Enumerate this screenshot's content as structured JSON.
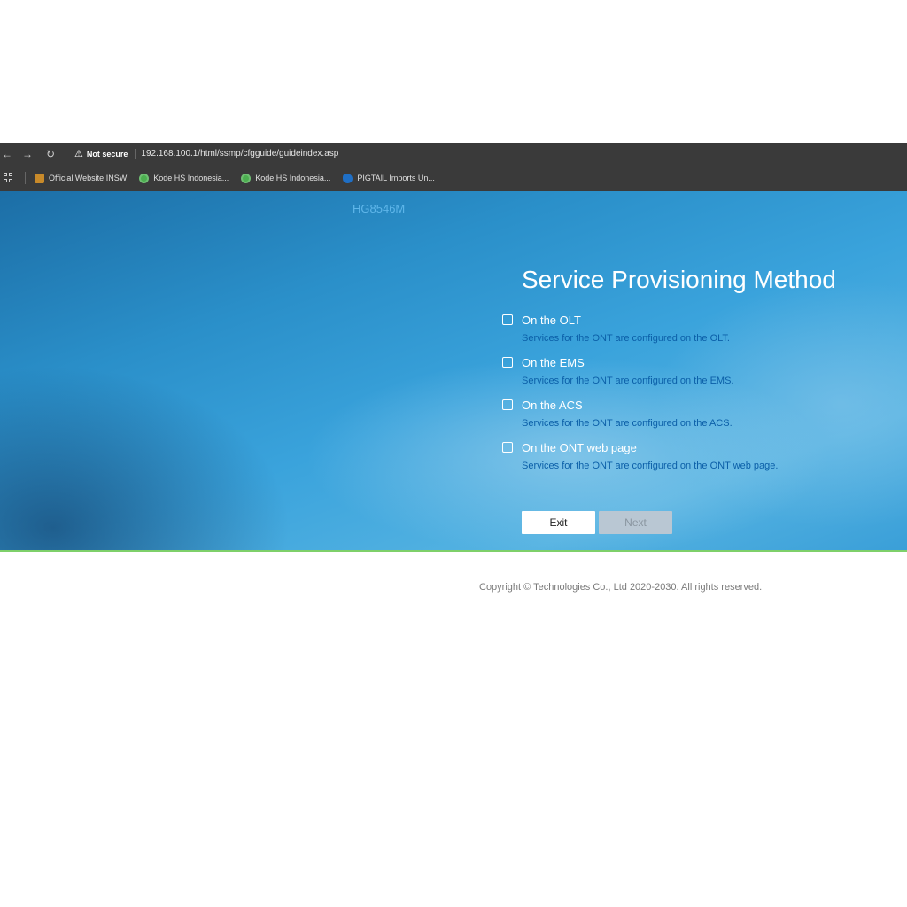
{
  "browser": {
    "nav": {
      "back": "←",
      "forward": "→",
      "reload": "↻"
    },
    "security_warning_glyph": "⚠",
    "security_label": "Not secure",
    "url": "192.168.100.1/html/ssmp/cfgguide/guideindex.asp",
    "bookmarks": [
      {
        "label": "Official Website INSW",
        "icon": "insw-favicon"
      },
      {
        "label": "Kode HS Indonesia...",
        "icon": "kode-hs-favicon"
      },
      {
        "label": "Kode HS Indonesia...",
        "icon": "kode-hs-favicon"
      },
      {
        "label": "PIGTAIL Imports Un...",
        "icon": "pigtail-favicon"
      }
    ]
  },
  "page": {
    "model": "HG8546M",
    "title": "Service Provisioning Method",
    "options": [
      {
        "label": "On the OLT",
        "description": "Services for the ONT are configured on the OLT.",
        "checked": false
      },
      {
        "label": "On the EMS",
        "description": "Services for the ONT are configured on the EMS.",
        "checked": false
      },
      {
        "label": "On the ACS",
        "description": "Services for the ONT are configured on the ACS.",
        "checked": false
      },
      {
        "label": "On the ONT web page",
        "description": "Services for the ONT are configured on the ONT web page.",
        "checked": false
      }
    ],
    "buttons": {
      "exit": "Exit",
      "next": "Next"
    },
    "copyright": "Copyright © Technologies Co., Ltd 2020-2030. All rights reserved."
  },
  "colors": {
    "accent_green": "#7ed06a",
    "hero_blue": "#2a8fc9",
    "description_blue": "#0b5fa8",
    "next_disabled": "#b9c7d3"
  }
}
